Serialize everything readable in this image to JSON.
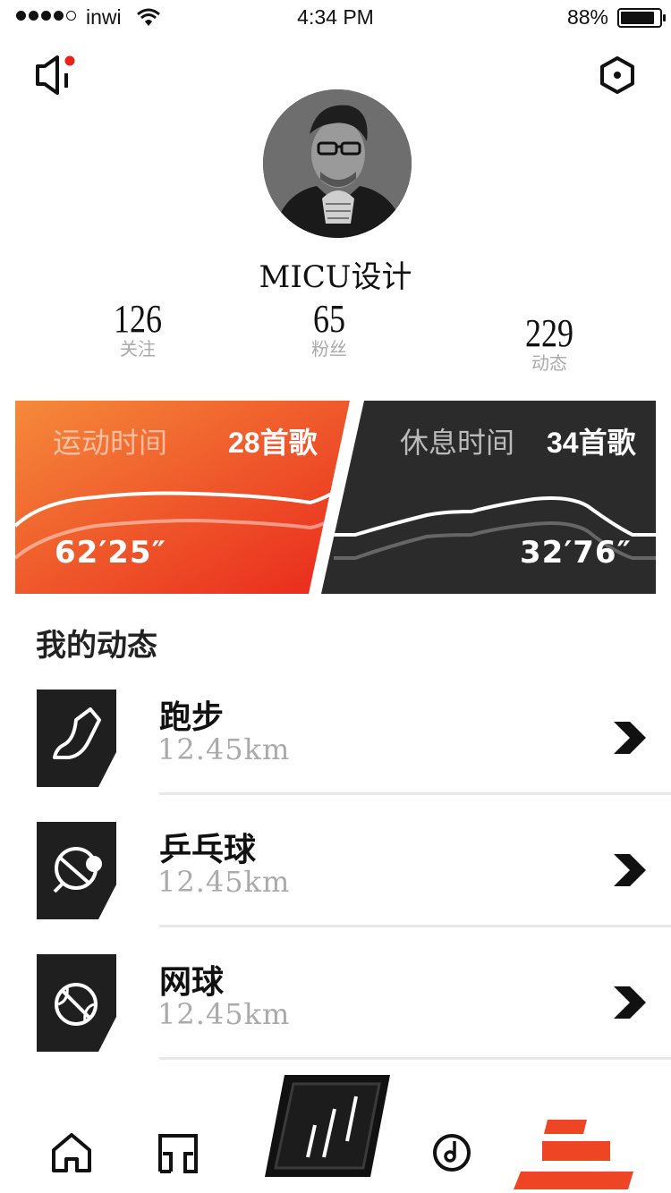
{
  "status_bar": {
    "carrier": "inwi",
    "time": "4:34 PM",
    "battery": "88%",
    "battery_level": 0.88
  },
  "header": {
    "left_icon": "speaker-icon",
    "right_icon": "settings-hexagon-icon",
    "notification_dot_color": "#e8231a"
  },
  "profile": {
    "name": "MICU设计",
    "stats": {
      "following": {
        "value": "126",
        "label": "关注"
      },
      "fans": {
        "value": "65",
        "label": "粉丝"
      },
      "posts": {
        "value": "229",
        "label": "动态"
      }
    }
  },
  "cards": {
    "exercise": {
      "title": "运动时间",
      "songs": "28首歌",
      "duration": "62′25″",
      "gradient": [
        "#f58a3a",
        "#e9281c"
      ]
    },
    "rest": {
      "title": "休息时间",
      "songs": "34首歌",
      "duration": "32′76″",
      "color": "#2b2b2b"
    }
  },
  "feed": {
    "title": "我的动态",
    "items": [
      {
        "title": "跑步",
        "distance": "12.45km",
        "icon": "shoe-icon"
      },
      {
        "title": "乒乓球",
        "distance": "12.45km",
        "icon": "ping-pong-icon"
      },
      {
        "title": "网球",
        "distance": "12.45km",
        "icon": "tennis-ball-icon"
      }
    ]
  },
  "tabbar": {
    "tabs": [
      "home-icon",
      "headphones-icon",
      "center-play-icon",
      "music-disc-icon",
      "profile-stack-icon"
    ],
    "active": "profile-stack-icon",
    "accent": "#ee4524"
  }
}
